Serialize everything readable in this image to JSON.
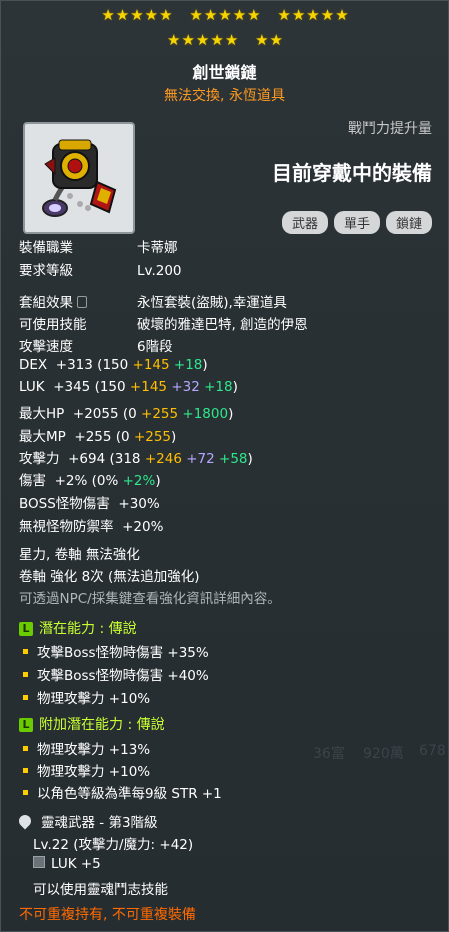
{
  "stars_row1": [
    "★★★★★",
    "★★★★★",
    "★★★★★"
  ],
  "stars_row2": [
    "★★★★★",
    "★★"
  ],
  "item": {
    "name": "創世鎖鏈",
    "subtitle": "無法交換, 永恆道具",
    "power_label": "戰鬥力提升量",
    "equipped_label": "目前穿戴中的裝備",
    "tags": [
      "武器",
      "單手",
      "鎖鏈"
    ]
  },
  "info": {
    "job_label": "裝備職業",
    "job_value": "卡蒂娜",
    "level_label": "要求等級",
    "level_value": "Lv.200",
    "set_label": "套組效果",
    "set_value": "永恆套裝(盜賊),幸運道具",
    "skill_label": "可使用技能",
    "skill_value": "破壞的雅達巴特, 創造的伊恩",
    "speed_label": "攻擊速度",
    "speed_value": "6階段"
  },
  "stats": {
    "dex": {
      "label": "DEX",
      "total": "+313",
      "base": "(150",
      "a": "+145",
      "b": "+18",
      "close": ")"
    },
    "luk": {
      "label": "LUK",
      "total": "+345",
      "base": "(150",
      "a": "+145",
      "p": "+32",
      "b": "+18",
      "close": ")"
    },
    "hp": {
      "label": "最大HP",
      "total": "+2055",
      "base": "(0",
      "a": "+255",
      "b": "+1800",
      "close": ")"
    },
    "mp": {
      "label": "最大MP",
      "total": "+255",
      "base": "(0",
      "a": "+255",
      "close": ")"
    },
    "atk": {
      "label": "攻擊力",
      "total": "+694",
      "base": "(318",
      "a": "+246",
      "p": "+72",
      "b": "+58",
      "close": ")"
    },
    "dmg": {
      "label": "傷害",
      "total": "+2%",
      "base": "(0%",
      "b": "+2%",
      "close": ")"
    },
    "boss": {
      "label": "BOSS怪物傷害",
      "total": "+30%"
    },
    "ied": {
      "label": "無視怪物防禦率",
      "total": "+20%"
    }
  },
  "enhance": {
    "star": "星力, 卷軸 無法強化",
    "scroll": "卷軸 強化 8次 (無法追加強化)",
    "note": "可透過NPC/採集鍵查看強化資訊詳細內容。"
  },
  "potential": {
    "badge": "L",
    "head": "潛在能力 : 傳說",
    "lines": [
      "攻擊Boss怪物時傷害 +35%",
      "攻擊Boss怪物時傷害 +40%",
      "物理攻擊力 +10%"
    ]
  },
  "bonus": {
    "badge": "L",
    "head": "附加潛在能力 : 傳說",
    "lines": [
      "物理攻擊力 +13%",
      "物理攻擊力 +10%",
      "以角色等級為準每9級 STR +1"
    ]
  },
  "soul": {
    "head": "靈魂武器 - 第3階級",
    "level": "Lv.22 (攻擊力/魔力: +42)",
    "stat": "LUK +5",
    "skill": "可以使用靈魂鬥志技能"
  },
  "footer": "不可重複持有, 不可重複裝備",
  "background_faint": [
    "36富",
    "920萬",
    "678"
  ],
  "colors": {
    "accent_orange": "#ff9a20",
    "star_yellow": "#f5d400",
    "potential_green": "#c8ff32",
    "footer_orange": "#ff6a00"
  }
}
